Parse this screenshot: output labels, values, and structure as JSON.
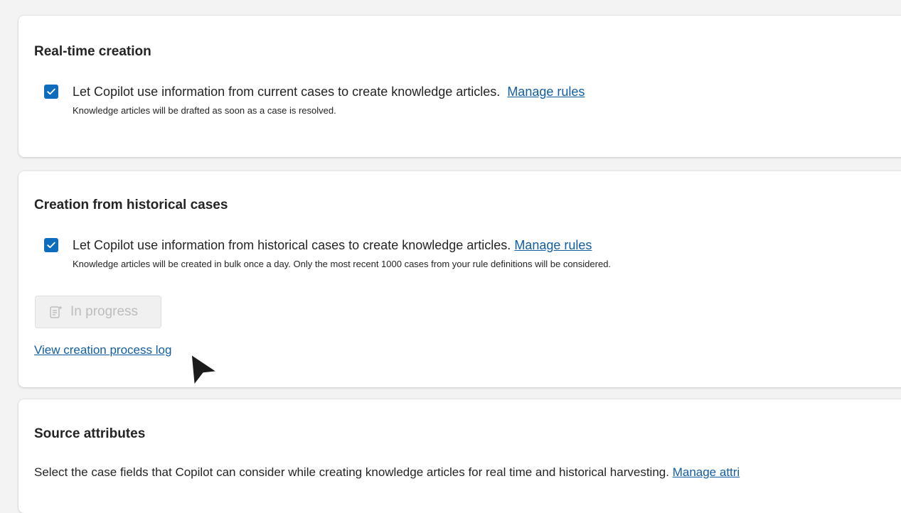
{
  "realtime": {
    "title": "Real-time creation",
    "checkbox_checked": true,
    "option_text": "Let Copilot use information from current cases to create knowledge articles.",
    "link_label": "Manage rules",
    "note": "Knowledge articles will be drafted as soon as a case is resolved."
  },
  "historical": {
    "title": "Creation from historical cases",
    "checkbox_checked": true,
    "option_text": "Let Copilot use information from historical cases to create knowledge articles.",
    "link_label": "Manage rules",
    "note": "Knowledge articles will be created in bulk once a day. Only the most recent 1000 cases from your rule definitions will be considered.",
    "button_label": "In progress",
    "button_icon": "document-sparkle-icon",
    "log_link": "View creation process log"
  },
  "source": {
    "title": "Source attributes",
    "description": "Select the case fields that Copilot can consider while creating knowledge articles for real time and historical harvesting.",
    "link_label": "Manage attri"
  },
  "colors": {
    "accent": "#0f6cbd",
    "link": "#115ea3",
    "disabled_text": "#bdbdbd"
  }
}
